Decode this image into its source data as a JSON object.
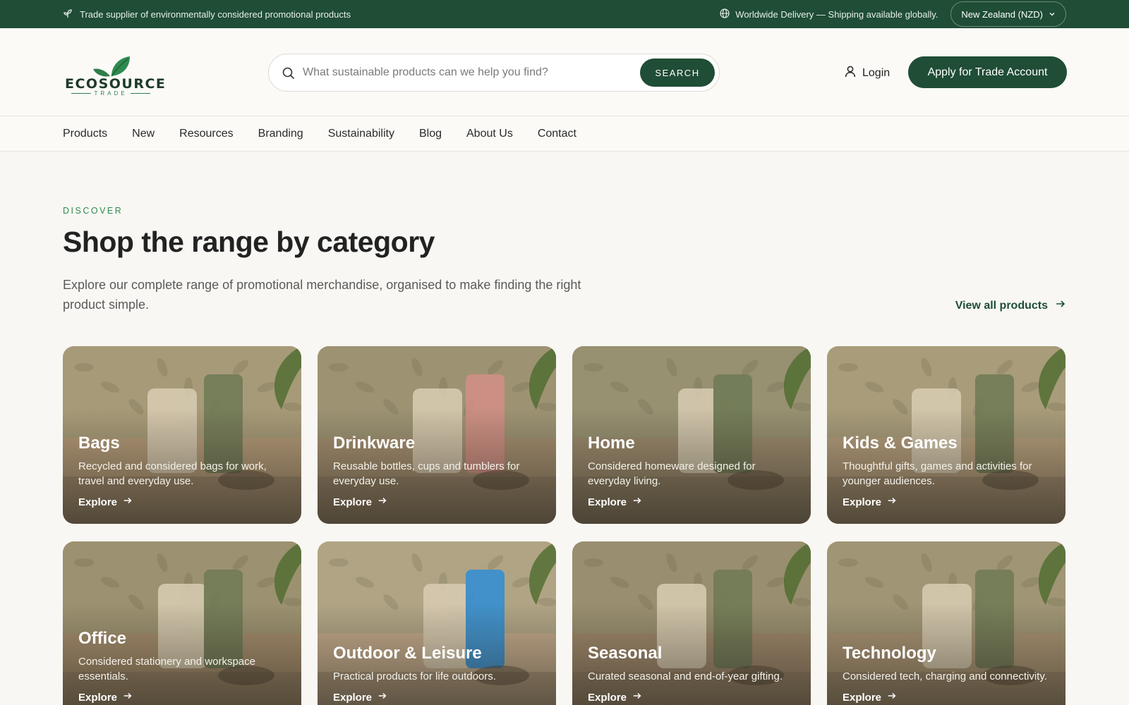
{
  "topbar": {
    "tagline": "Trade supplier of environmentally considered promotional products",
    "delivery": "Worldwide Delivery — Shipping available globally.",
    "region": "New Zealand (NZD)"
  },
  "header": {
    "logo_word": "ECOSOURCE",
    "logo_sub": "TRADE",
    "search_placeholder": "What sustainable products can we help you find?",
    "search_button": "SEARCH",
    "login_label": "Login",
    "apply_label": "Apply for Trade Account"
  },
  "nav": {
    "items": [
      "Products",
      "New",
      "Resources",
      "Branding",
      "Sustainability",
      "Blog",
      "About Us",
      "Contact"
    ]
  },
  "section": {
    "eyebrow": "DISCOVER",
    "title": "Shop the range by category",
    "description": "Explore our complete range of promotional merchandise, organised to make finding the right product simple.",
    "view_all": "View all products"
  },
  "categories": [
    {
      "name": "Bags",
      "description": "Recycled and considered bags for work, travel and everyday use.",
      "explore": "Explore",
      "bg": "#b49a78"
    },
    {
      "name": "Drinkware",
      "description": "Reusable bottles, cups and tumblers for everyday use.",
      "explore": "Explore",
      "bg": "#a58f70"
    },
    {
      "name": "Home",
      "description": "Considered homeware designed for everyday living.",
      "explore": "Explore",
      "bg": "#9c8a6d"
    },
    {
      "name": "Kids & Games",
      "description": "Thoughtful gifts, games and activities for younger audiences.",
      "explore": "Explore",
      "bg": "#b59d7b"
    },
    {
      "name": "Office",
      "description": "Considered stationery and workspace essentials.",
      "explore": "Explore",
      "bg": "#a48c6c"
    },
    {
      "name": "Outdoor & Leisure",
      "description": "Practical products for life outdoors.",
      "explore": "Explore",
      "bg": "#c2a98a"
    },
    {
      "name": "Seasonal",
      "description": "Curated seasonal and end-of-year gifting.",
      "explore": "Explore",
      "bg": "#9e876a"
    },
    {
      "name": "Technology",
      "description": "Considered tech, charging and connectivity.",
      "explore": "Explore",
      "bg": "#a99373"
    }
  ],
  "colors": {
    "brand": "#1f4d35",
    "accent": "#2f8a4f",
    "background": "#f8f7f3"
  }
}
